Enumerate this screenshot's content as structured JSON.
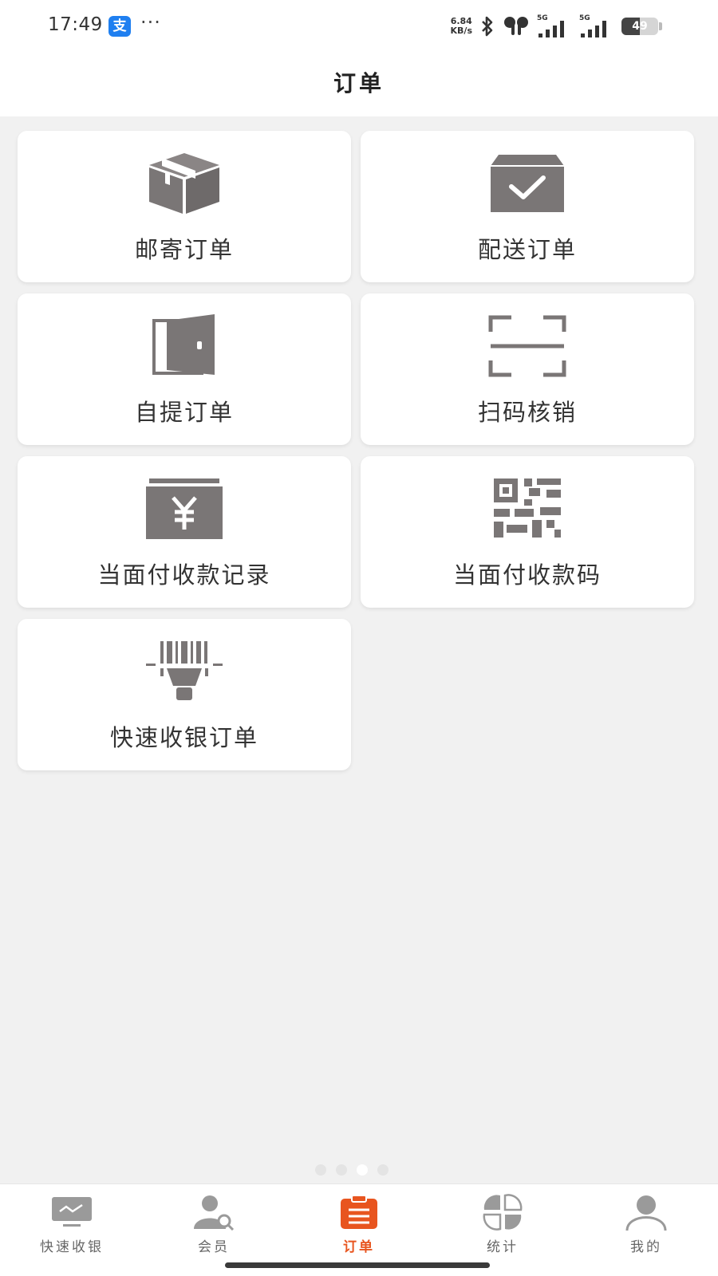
{
  "status_bar": {
    "time": "17:49",
    "app_badge": "支",
    "dots": "···",
    "net_speed_value": "6.84",
    "net_speed_unit": "KB/s",
    "signal1_label": "5G",
    "signal2_label": "5G",
    "battery_percent": "49",
    "battery_level": 0.49
  },
  "header": {
    "title": "订单"
  },
  "menu": {
    "items": [
      {
        "label": "邮寄订单",
        "icon": "package-box-icon"
      },
      {
        "label": "配送订单",
        "icon": "delivery-box-check-icon"
      },
      {
        "label": "自提订单",
        "icon": "door-icon"
      },
      {
        "label": "扫码核销",
        "icon": "scan-frame-icon"
      },
      {
        "label": "当面付收款记录",
        "icon": "yen-wallet-icon"
      },
      {
        "label": "当面付收款码",
        "icon": "qr-code-icon"
      },
      {
        "label": "快速收银订单",
        "icon": "barcode-scanner-icon"
      }
    ]
  },
  "tabbar": {
    "items": [
      {
        "label": "快速收银",
        "icon": "monitor-icon"
      },
      {
        "label": "会员",
        "icon": "member-search-icon"
      },
      {
        "label": "订单",
        "icon": "clipboard-icon"
      },
      {
        "label": "统计",
        "icon": "statistics-petals-icon"
      },
      {
        "label": "我的",
        "icon": "user-profile-icon"
      }
    ],
    "active_index": 2
  },
  "colors": {
    "accent": "#e8551f",
    "icon_gray": "#7a7676",
    "tab_gray": "#9a9a9a",
    "background": "#f1f1f1"
  }
}
